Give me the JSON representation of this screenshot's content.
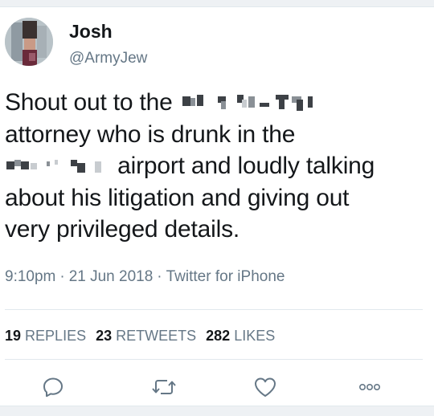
{
  "author": {
    "display_name": "Josh",
    "handle": "@ArmyJew"
  },
  "tweet": {
    "line1": "Shout out to the",
    "line2": "attorney who is drunk in the",
    "line3": "airport and loudly talking",
    "line4": "about his litigation and giving out",
    "line5": "very privileged details."
  },
  "meta": {
    "time": "9:10pm",
    "date": "21 Jun 2018",
    "source": "Twitter for iPhone",
    "separator": "·"
  },
  "stats": {
    "replies_count": "19",
    "replies_label": "REPLIES",
    "retweets_count": "23",
    "retweets_label": "RETWEETS",
    "likes_count": "282",
    "likes_label": "LIKES"
  },
  "actions": {
    "reply_icon": "reply-icon",
    "retweet_icon": "retweet-icon",
    "like_icon": "heart-icon",
    "more_icon": "more-icon"
  },
  "colors": {
    "text": "#14171a",
    "secondary": "#657786",
    "divider": "#e1e8ed"
  }
}
